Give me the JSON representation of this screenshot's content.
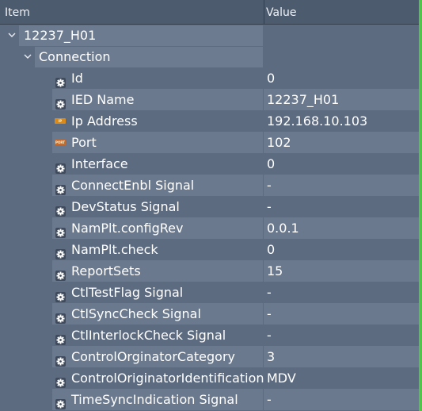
{
  "header": {
    "item_label": "Item",
    "value_label": "Value"
  },
  "tree": {
    "root_label": "12237_H01",
    "connection_label": "Connection"
  },
  "properties": [
    {
      "name": "Id",
      "value": "0",
      "icon": "gear-icon"
    },
    {
      "name": "IED Name",
      "value": "12237_H01",
      "icon": "gear-icon"
    },
    {
      "name": "Ip Address",
      "value": "192.168.10.103",
      "icon": "ip-address-tag-icon",
      "tag": "IP ADR"
    },
    {
      "name": "Port",
      "value": "102",
      "icon": "port-tag-icon",
      "tag": "PORT"
    },
    {
      "name": "Interface",
      "value": "0",
      "icon": "gear-icon"
    },
    {
      "name": "ConnectEnbl Signal",
      "value": "-",
      "icon": "gear-icon"
    },
    {
      "name": "DevStatus Signal",
      "value": "-",
      "icon": "gear-icon"
    },
    {
      "name": "NamPlt.configRev",
      "value": "0.0.1",
      "icon": "gear-icon"
    },
    {
      "name": "NamPlt.check",
      "value": "0",
      "icon": "gear-icon"
    },
    {
      "name": "ReportSets",
      "value": "15",
      "icon": "gear-icon"
    },
    {
      "name": "CtlTestFlag Signal",
      "value": "-",
      "icon": "gear-icon"
    },
    {
      "name": "CtlSyncCheck Signal",
      "value": "-",
      "icon": "gear-icon"
    },
    {
      "name": "CtlInterlockCheck Signal",
      "value": "-",
      "icon": "gear-icon"
    },
    {
      "name": "ControlOrginatorCategory",
      "value": "3",
      "icon": "gear-icon"
    },
    {
      "name": "ControlOriginatorIdentification",
      "value": "MDV",
      "icon": "gear-icon"
    },
    {
      "name": "TimeSyncIndication Signal",
      "value": "-",
      "icon": "gear-icon"
    }
  ],
  "colors": {
    "panel": "#5d6b80",
    "alt_row": "#6b798e",
    "header": "#4d5b6e",
    "accent_strip": "#4fc64a"
  }
}
